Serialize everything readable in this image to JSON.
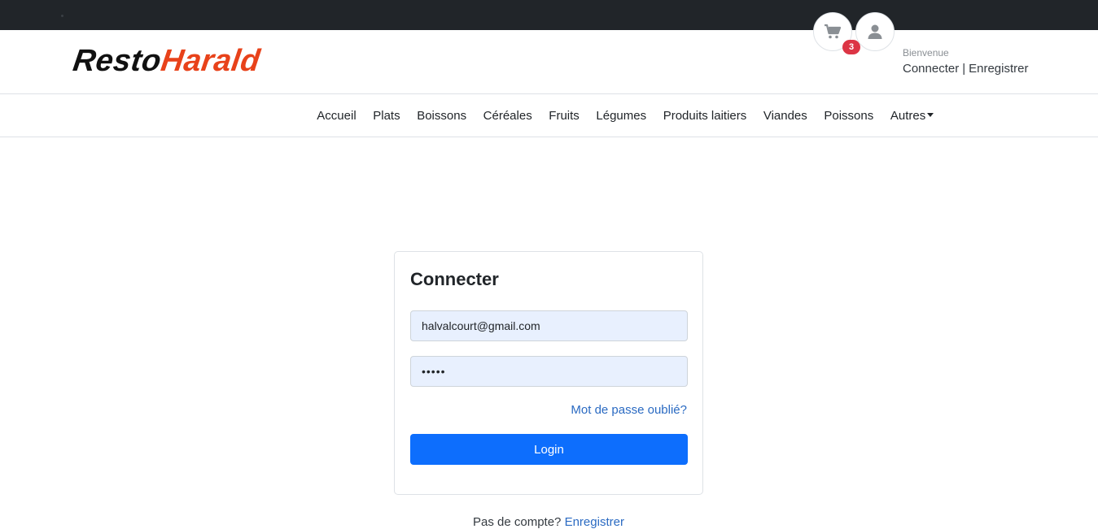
{
  "brand": {
    "part1": "Resto",
    "part2": "Harald",
    "part1_color": "#111111",
    "part2_color": "#e8421a"
  },
  "header": {
    "cart_icon": "shopping-cart-icon",
    "cart_count": "3",
    "user_icon": "user-icon",
    "welcome": "Bienvenue",
    "login_link": "Connecter",
    "separator": "|",
    "register_link": "Enregistrer"
  },
  "nav": {
    "items": [
      "Accueil",
      "Plats",
      "Boissons",
      "Céréales",
      "Fruits",
      "Légumes",
      "Produits laitiers",
      "Viandes",
      "Poissons",
      "Autres"
    ]
  },
  "login": {
    "title": "Connecter",
    "email_value": "halvalcourt@gmail.com",
    "password_value": "•••••",
    "forgot_link": "Mot de passe oublié?",
    "submit_label": "Login"
  },
  "footer": {
    "no_account": "Pas de compte?",
    "register_link": "Enregistrer"
  },
  "colors": {
    "primary": "#0d6efd",
    "badge": "#dc3545",
    "topbar": "#212529"
  }
}
